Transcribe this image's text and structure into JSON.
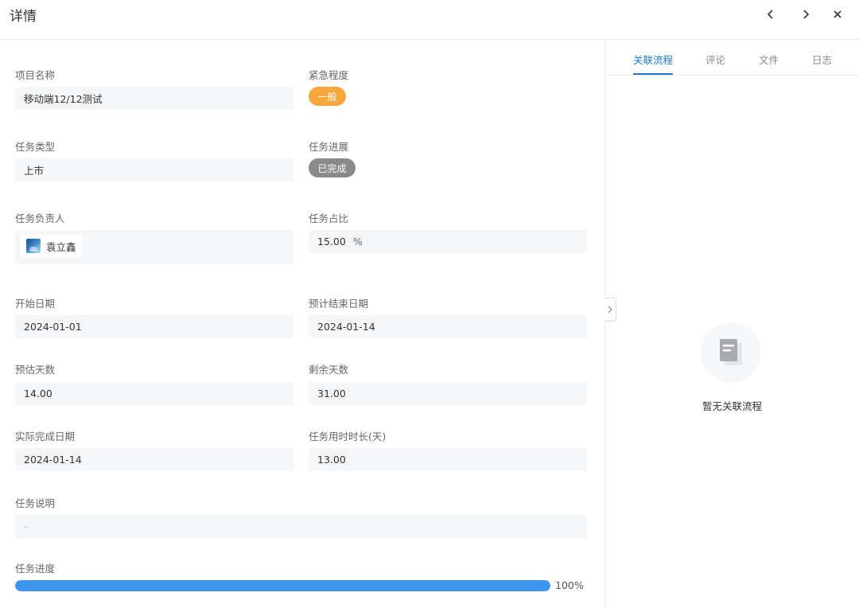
{
  "header": {
    "title": "详情",
    "icons": [
      "chevron-left-icon",
      "chevron-right-icon",
      "close-icon"
    ]
  },
  "form": {
    "project_name": {
      "label": "项目名称",
      "value": "移动端12/12测试"
    },
    "urgency": {
      "label": "紧急程度",
      "value": "一般",
      "color": "#f8a73a"
    },
    "task_type": {
      "label": "任务类型",
      "value": "上市"
    },
    "task_status": {
      "label": "任务进展",
      "value": "已完成",
      "color": "#8a8a8a"
    },
    "owner": {
      "label": "任务负责人",
      "value": "袁立鑫"
    },
    "ratio": {
      "label": "任务占比",
      "value": "15.00",
      "unit": "%"
    },
    "start_date": {
      "label": "开始日期",
      "value": "2024-01-01"
    },
    "end_date": {
      "label": "预计结束日期",
      "value": "2024-01-14"
    },
    "est_days": {
      "label": "预估天数",
      "value": "14.00"
    },
    "remain_days": {
      "label": "剩余天数",
      "value": "31.00"
    },
    "actual_date": {
      "label": "实际完成日期",
      "value": "2024-01-14"
    },
    "duration": {
      "label": "任务用时时长(天)",
      "value": "13.00"
    },
    "description": {
      "label": "任务说明",
      "value": "-"
    },
    "progress": {
      "label": "任务进度",
      "value": 100,
      "text": "100%",
      "color": "#3d95f0"
    }
  },
  "side": {
    "tabs": [
      {
        "label": "关联流程",
        "active": true
      },
      {
        "label": "评论",
        "active": false
      },
      {
        "label": "文件",
        "active": false
      },
      {
        "label": "日志",
        "active": false
      }
    ],
    "accent": "#1f78d1",
    "empty_text": "暂无关联流程",
    "empty_icon": "document-icon",
    "collapse_icon": "chevron-right-icon"
  }
}
